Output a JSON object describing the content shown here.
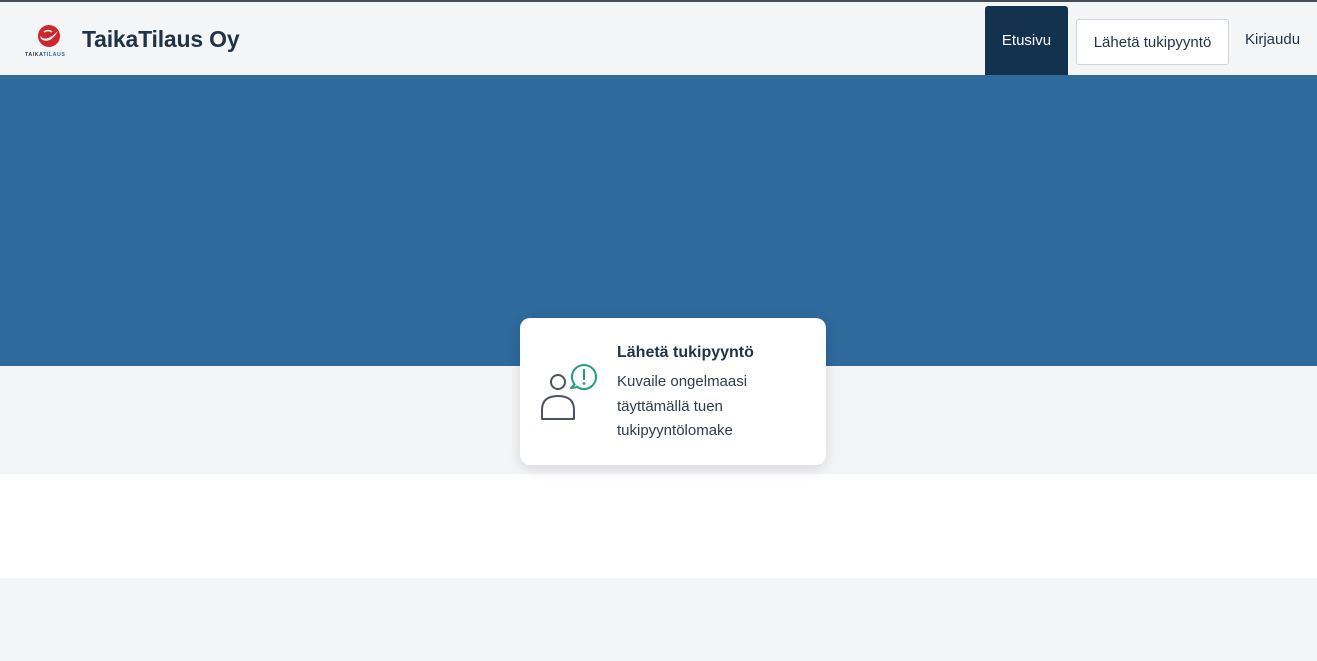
{
  "header": {
    "logo_text": "TAIKATILAUS",
    "brand": "TaikaTilaus Oy",
    "nav": {
      "home": "Etusivu",
      "support": "Lähetä tukipyyntö",
      "login": "Kirjaudu"
    }
  },
  "card": {
    "icon": "user-alert-icon",
    "title": "Lähetä tukipyyntö",
    "description": "Kuvaile ongelmaasi täyttämällä tuen tukipyyntölomake"
  },
  "colors": {
    "hero": "#2e6a9c",
    "nav_active": "#13324f",
    "brand_text": "#1f3347",
    "accent_green": "#1ea37a",
    "logo_red": "#d3242c"
  }
}
